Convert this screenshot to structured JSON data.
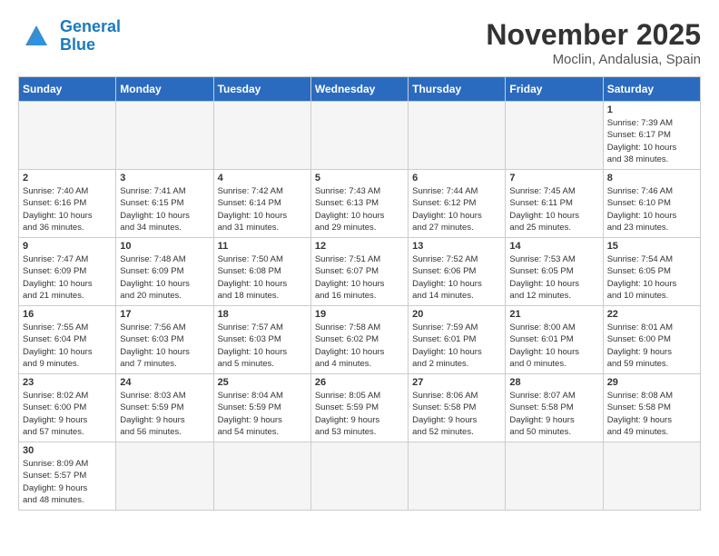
{
  "logo": {
    "general": "General",
    "blue": "Blue"
  },
  "title": "November 2025",
  "location": "Moclin, Andalusia, Spain",
  "days_of_week": [
    "Sunday",
    "Monday",
    "Tuesday",
    "Wednesday",
    "Thursday",
    "Friday",
    "Saturday"
  ],
  "weeks": [
    [
      {
        "day": "",
        "info": "",
        "empty": true
      },
      {
        "day": "",
        "info": "",
        "empty": true
      },
      {
        "day": "",
        "info": "",
        "empty": true
      },
      {
        "day": "",
        "info": "",
        "empty": true
      },
      {
        "day": "",
        "info": "",
        "empty": true
      },
      {
        "day": "",
        "info": "",
        "empty": true
      },
      {
        "day": "1",
        "info": "Sunrise: 7:39 AM\nSunset: 6:17 PM\nDaylight: 10 hours\nand 38 minutes."
      }
    ],
    [
      {
        "day": "2",
        "info": "Sunrise: 7:40 AM\nSunset: 6:16 PM\nDaylight: 10 hours\nand 36 minutes."
      },
      {
        "day": "3",
        "info": "Sunrise: 7:41 AM\nSunset: 6:15 PM\nDaylight: 10 hours\nand 34 minutes."
      },
      {
        "day": "4",
        "info": "Sunrise: 7:42 AM\nSunset: 6:14 PM\nDaylight: 10 hours\nand 31 minutes."
      },
      {
        "day": "5",
        "info": "Sunrise: 7:43 AM\nSunset: 6:13 PM\nDaylight: 10 hours\nand 29 minutes."
      },
      {
        "day": "6",
        "info": "Sunrise: 7:44 AM\nSunset: 6:12 PM\nDaylight: 10 hours\nand 27 minutes."
      },
      {
        "day": "7",
        "info": "Sunrise: 7:45 AM\nSunset: 6:11 PM\nDaylight: 10 hours\nand 25 minutes."
      },
      {
        "day": "8",
        "info": "Sunrise: 7:46 AM\nSunset: 6:10 PM\nDaylight: 10 hours\nand 23 minutes."
      }
    ],
    [
      {
        "day": "9",
        "info": "Sunrise: 7:47 AM\nSunset: 6:09 PM\nDaylight: 10 hours\nand 21 minutes."
      },
      {
        "day": "10",
        "info": "Sunrise: 7:48 AM\nSunset: 6:09 PM\nDaylight: 10 hours\nand 20 minutes."
      },
      {
        "day": "11",
        "info": "Sunrise: 7:50 AM\nSunset: 6:08 PM\nDaylight: 10 hours\nand 18 minutes."
      },
      {
        "day": "12",
        "info": "Sunrise: 7:51 AM\nSunset: 6:07 PM\nDaylight: 10 hours\nand 16 minutes."
      },
      {
        "day": "13",
        "info": "Sunrise: 7:52 AM\nSunset: 6:06 PM\nDaylight: 10 hours\nand 14 minutes."
      },
      {
        "day": "14",
        "info": "Sunrise: 7:53 AM\nSunset: 6:05 PM\nDaylight: 10 hours\nand 12 minutes."
      },
      {
        "day": "15",
        "info": "Sunrise: 7:54 AM\nSunset: 6:05 PM\nDaylight: 10 hours\nand 10 minutes."
      }
    ],
    [
      {
        "day": "16",
        "info": "Sunrise: 7:55 AM\nSunset: 6:04 PM\nDaylight: 10 hours\nand 9 minutes."
      },
      {
        "day": "17",
        "info": "Sunrise: 7:56 AM\nSunset: 6:03 PM\nDaylight: 10 hours\nand 7 minutes."
      },
      {
        "day": "18",
        "info": "Sunrise: 7:57 AM\nSunset: 6:03 PM\nDaylight: 10 hours\nand 5 minutes."
      },
      {
        "day": "19",
        "info": "Sunrise: 7:58 AM\nSunset: 6:02 PM\nDaylight: 10 hours\nand 4 minutes."
      },
      {
        "day": "20",
        "info": "Sunrise: 7:59 AM\nSunset: 6:01 PM\nDaylight: 10 hours\nand 2 minutes."
      },
      {
        "day": "21",
        "info": "Sunrise: 8:00 AM\nSunset: 6:01 PM\nDaylight: 10 hours\nand 0 minutes."
      },
      {
        "day": "22",
        "info": "Sunrise: 8:01 AM\nSunset: 6:00 PM\nDaylight: 9 hours\nand 59 minutes."
      }
    ],
    [
      {
        "day": "23",
        "info": "Sunrise: 8:02 AM\nSunset: 6:00 PM\nDaylight: 9 hours\nand 57 minutes."
      },
      {
        "day": "24",
        "info": "Sunrise: 8:03 AM\nSunset: 5:59 PM\nDaylight: 9 hours\nand 56 minutes."
      },
      {
        "day": "25",
        "info": "Sunrise: 8:04 AM\nSunset: 5:59 PM\nDaylight: 9 hours\nand 54 minutes."
      },
      {
        "day": "26",
        "info": "Sunrise: 8:05 AM\nSunset: 5:59 PM\nDaylight: 9 hours\nand 53 minutes."
      },
      {
        "day": "27",
        "info": "Sunrise: 8:06 AM\nSunset: 5:58 PM\nDaylight: 9 hours\nand 52 minutes."
      },
      {
        "day": "28",
        "info": "Sunrise: 8:07 AM\nSunset: 5:58 PM\nDaylight: 9 hours\nand 50 minutes."
      },
      {
        "day": "29",
        "info": "Sunrise: 8:08 AM\nSunset: 5:58 PM\nDaylight: 9 hours\nand 49 minutes."
      }
    ],
    [
      {
        "day": "30",
        "info": "Sunrise: 8:09 AM\nSunset: 5:57 PM\nDaylight: 9 hours\nand 48 minutes."
      },
      {
        "day": "",
        "info": "",
        "empty": true
      },
      {
        "day": "",
        "info": "",
        "empty": true
      },
      {
        "day": "",
        "info": "",
        "empty": true
      },
      {
        "day": "",
        "info": "",
        "empty": true
      },
      {
        "day": "",
        "info": "",
        "empty": true
      },
      {
        "day": "",
        "info": "",
        "empty": true
      }
    ]
  ]
}
